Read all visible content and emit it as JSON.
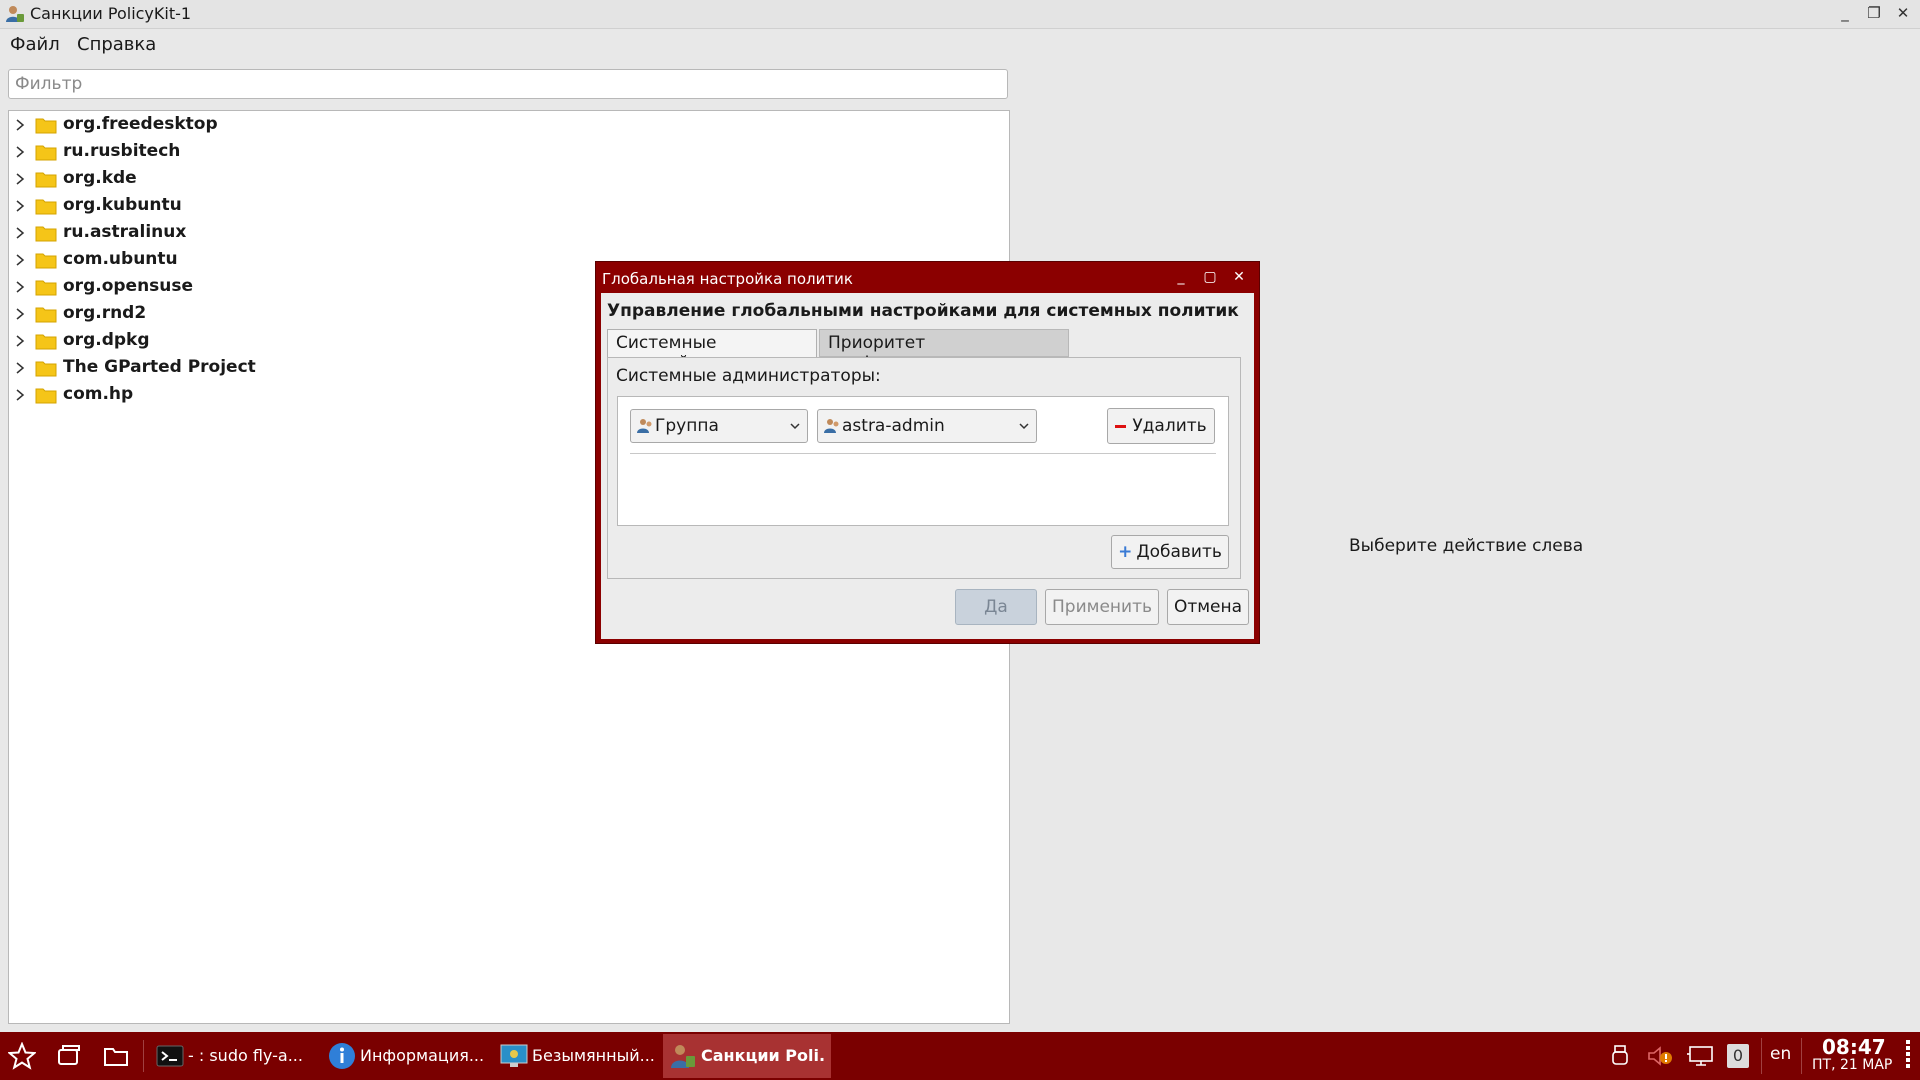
{
  "window": {
    "title": "Санкции PolicyKit-1"
  },
  "menu": {
    "items": [
      "Файл",
      "Справка"
    ]
  },
  "filter": {
    "placeholder": "Фильтр"
  },
  "tree": {
    "items": [
      "org.freedesktop",
      "ru.rusbitech",
      "org.kde",
      "org.kubuntu",
      "ru.astralinux",
      "com.ubuntu",
      "org.opensuse",
      "org.rnd2",
      "org.dpkg",
      "The GParted Project",
      "com.hp"
    ]
  },
  "right_panel": {
    "hint": "Выберите действие слева"
  },
  "dialog": {
    "title": "Глобальная настройка политик",
    "heading": "Управление глобальными настройками для системных политик",
    "tabs": [
      "Системные настройки",
      "Приоритет конфигурации"
    ],
    "admins_label": "Системные администраторы:",
    "type_combo": "Группа",
    "name_combo": "astra-admin",
    "remove_label": "Удалить",
    "add_label": "Добавить",
    "ok_label": "Да",
    "apply_label": "Применить",
    "cancel_label": "Отмена"
  },
  "taskbar": {
    "tasks": [
      {
        "label": "- : sudo fly-a...",
        "icon": "terminal-icon"
      },
      {
        "label": "Информация...",
        "icon": "info-icon"
      },
      {
        "label": "Безымянный...",
        "icon": "monitor-icon"
      },
      {
        "label": "Санкции Poli...",
        "icon": "policykit-icon"
      }
    ],
    "keyboard_layout": "en",
    "notification_count": "0",
    "clock": {
      "time": "08:47",
      "date": "ПТ, 21 МАР"
    }
  },
  "colors": {
    "accent": "#8b0000",
    "taskbar": "#7a0000",
    "folder": "#f5c518"
  }
}
